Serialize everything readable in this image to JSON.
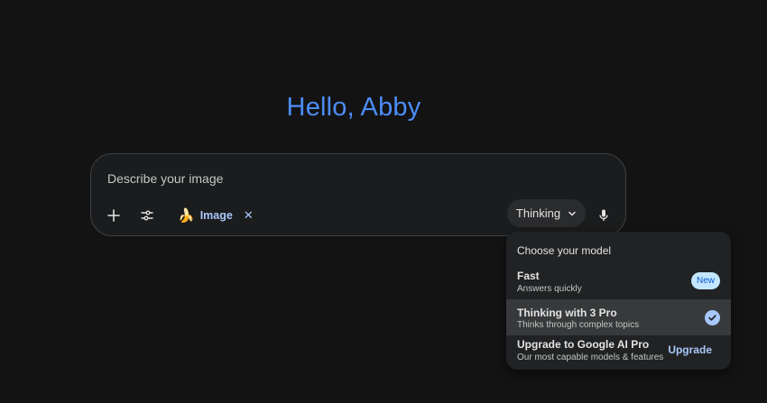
{
  "greeting": "Hello, Abby",
  "composer": {
    "placeholder": "Describe your image",
    "add_icon": "plus-icon",
    "tools_icon": "tune-icon",
    "image_chip": {
      "icon": "banana-icon",
      "label": "Image",
      "close": "✕"
    },
    "model_picker": {
      "label": "Thinking",
      "icon": "chevron-down-icon"
    },
    "mic_icon": "mic-icon"
  },
  "model_menu": {
    "heading": "Choose your model",
    "items": [
      {
        "title": "Fast",
        "subtitle": "Answers quickly",
        "badge": "New"
      },
      {
        "title": "Thinking with 3 Pro",
        "subtitle": "Thinks through complex topics",
        "selected": true
      },
      {
        "title": "Upgrade to Google AI Pro",
        "subtitle": "Our most capable models & features",
        "action": "Upgrade"
      }
    ]
  },
  "colors": {
    "background": "#131314",
    "greeting": "#4c8df6",
    "accent": "#a8c7fa",
    "badge_bg": "#c2e7ff"
  }
}
